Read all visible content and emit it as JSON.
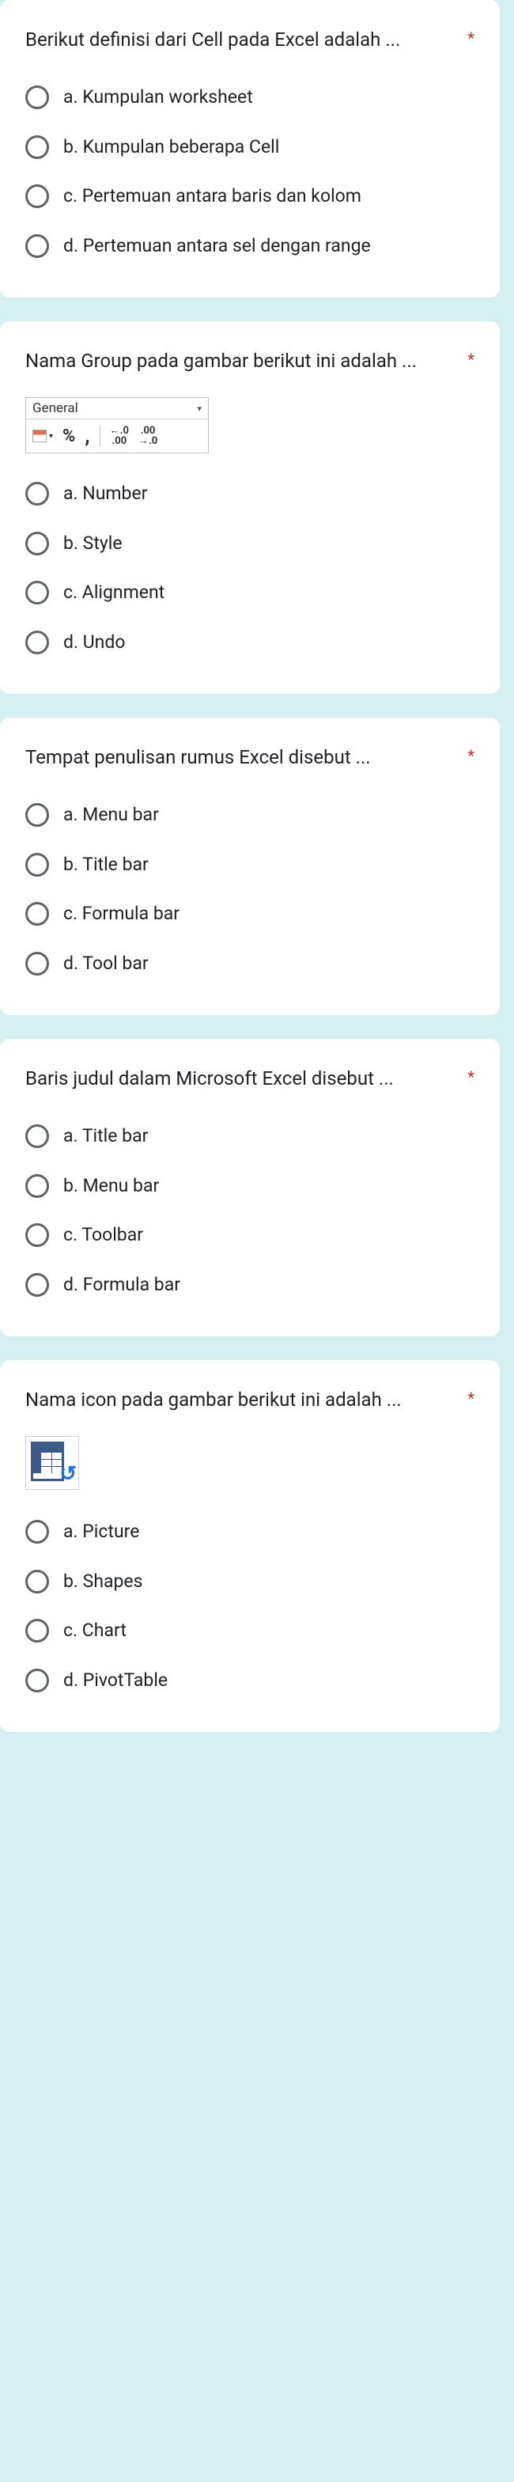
{
  "required_marker": "*",
  "questions": [
    {
      "title": "Berikut definisi dari Cell pada Excel adalah ...",
      "options": [
        "a. Kumpulan worksheet",
        "b. Kumpulan beberapa Cell",
        "c. Pertemuan antara baris dan kolom",
        "d. Pertemuan antara sel dengan range"
      ]
    },
    {
      "title": "Nama Group pada gambar berikut ini adalah ...",
      "image": "excel-number-group",
      "excel_group": {
        "dropdown_label": "General",
        "percent": "%",
        "comma": ",",
        "inc": ".0\n.00",
        "dec": ".00\n.0"
      },
      "options": [
        "a. Number",
        "b. Style",
        "c. Alignment",
        "d. Undo"
      ]
    },
    {
      "title": "Tempat penulisan rumus Excel disebut ...",
      "options": [
        "a. Menu bar",
        "b. Title bar",
        "c. Formula bar",
        "d. Tool bar"
      ]
    },
    {
      "title": "Baris judul dalam Microsoft Excel disebut ...",
      "options": [
        "a. Title bar",
        "b. Menu bar",
        "c. Toolbar",
        "d. Formula bar"
      ]
    },
    {
      "title": "Nama icon pada gambar berikut ini adalah ...",
      "image": "pivot-icon",
      "options": [
        "a. Picture",
        "b. Shapes",
        "c. Chart",
        "d. PivotTable"
      ]
    }
  ]
}
